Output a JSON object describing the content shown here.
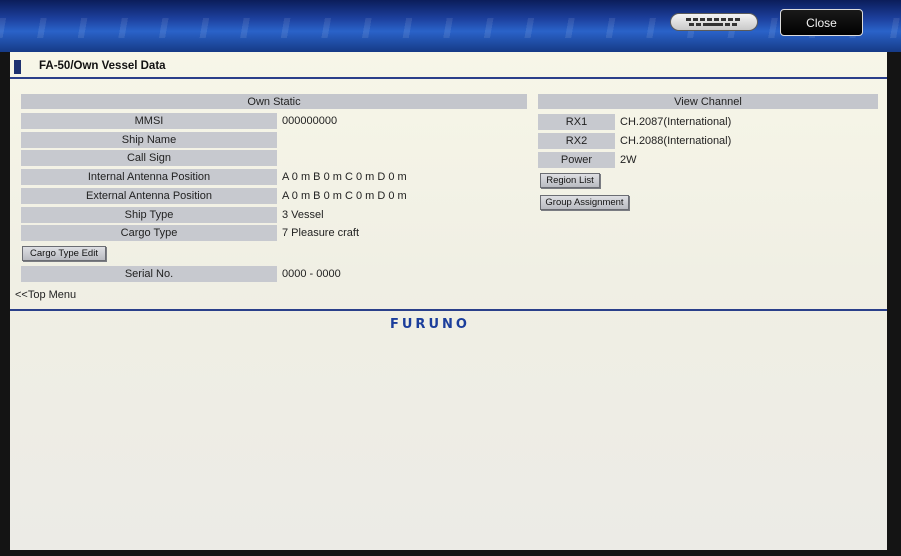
{
  "window": {
    "close_label": "Close",
    "keyboard_icon": "keyboard-icon"
  },
  "page": {
    "title": "FA-50/Own Vessel Data"
  },
  "own_static": {
    "header": "Own Static",
    "rows": [
      {
        "label": "MMSI",
        "value": "000000000"
      },
      {
        "label": "Ship Name",
        "value": ""
      },
      {
        "label": "Call Sign",
        "value": ""
      },
      {
        "label": "Internal Antenna Position",
        "value": "A 0 m B 0 m C 0 m D 0 m"
      },
      {
        "label": "External Antenna Position",
        "value": "A 0 m B 0 m C 0 m D 0 m"
      },
      {
        "label": "Ship Type",
        "value": "3 Vessel"
      },
      {
        "label": "Cargo Type",
        "value": "7 Pleasure craft"
      }
    ],
    "cargo_button": "Cargo Type Edit",
    "serial": {
      "label": "Serial No.",
      "value": "0000 - 0000"
    }
  },
  "view_channel": {
    "header": "View Channel",
    "rows": [
      {
        "label": "RX1",
        "value": "CH.2087(International)"
      },
      {
        "label": "RX2",
        "value": "CH.2088(International)"
      },
      {
        "label": "Power",
        "value": "2W"
      }
    ],
    "region_button": "Region List",
    "group_button": "Group Assignment"
  },
  "footer": {
    "top_menu_link": "<<Top Menu",
    "logo": "FURUNO"
  }
}
